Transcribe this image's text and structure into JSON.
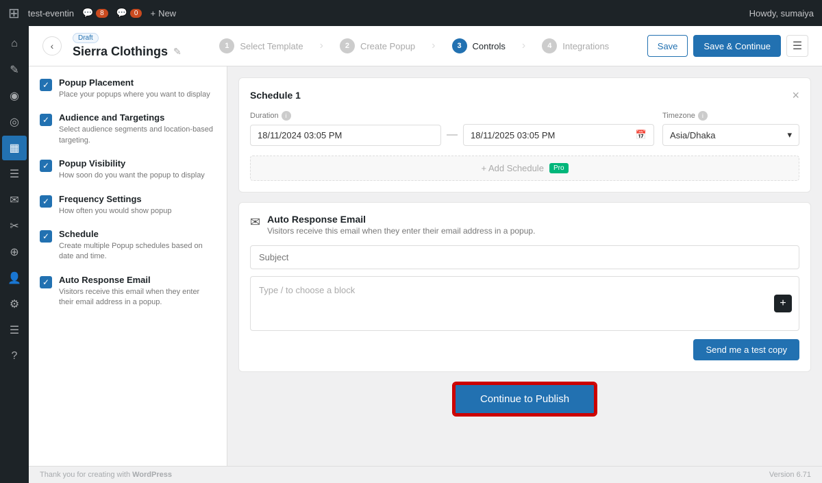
{
  "admin_bar": {
    "wp_icon": "⊞",
    "site_name": "test-eventin",
    "comments_count": "8",
    "notifications_count": "0",
    "new_label": "New",
    "howdy": "Howdy, sumaiya"
  },
  "wp_sidebar": {
    "icons": [
      {
        "name": "dashboard-icon",
        "symbol": "⌂"
      },
      {
        "name": "posts-icon",
        "symbol": "✎"
      },
      {
        "name": "users-icon",
        "symbol": "👤"
      },
      {
        "name": "analytics-icon",
        "symbol": "◎"
      },
      {
        "name": "settings-icon",
        "symbol": "⚙"
      },
      {
        "name": "plugin-icon",
        "symbol": "▦"
      },
      {
        "name": "pages-icon",
        "symbol": "☰"
      },
      {
        "name": "comments-icon",
        "symbol": "✉"
      },
      {
        "name": "tools-icon",
        "symbol": "✂"
      },
      {
        "name": "markers-icon",
        "symbol": "⊕"
      },
      {
        "name": "avatar-icon",
        "symbol": "👤"
      },
      {
        "name": "tools2-icon",
        "symbol": "✦"
      },
      {
        "name": "admin-icon",
        "symbol": "☰"
      },
      {
        "name": "help-icon",
        "symbol": "?"
      }
    ]
  },
  "header": {
    "back_label": "‹",
    "draft_label": "Draft",
    "title": "Sierra Clothings",
    "edit_icon": "✎",
    "steps": [
      {
        "number": "1",
        "label": "Select Template",
        "active": false
      },
      {
        "number": "2",
        "label": "Create Popup",
        "active": false
      },
      {
        "number": "3",
        "label": "Controls",
        "active": true
      },
      {
        "number": "4",
        "label": "Integrations",
        "active": false
      }
    ],
    "save_label": "Save",
    "save_continue_label": "Save & Continue",
    "notes_icon": "☰"
  },
  "sidebar": {
    "sections": [
      {
        "checked": true,
        "title": "Popup Placement",
        "description": "Place your popups where you want to display"
      },
      {
        "checked": true,
        "title": "Audience and Targetings",
        "description": "Select audience segments and location-based targeting."
      },
      {
        "checked": true,
        "title": "Popup Visibility",
        "description": "How soon do you want the popup to display"
      },
      {
        "checked": true,
        "title": "Frequency Settings",
        "description": "How often you would show popup"
      },
      {
        "checked": true,
        "title": "Schedule",
        "description": "Create multiple Popup schedules based on date and time."
      },
      {
        "checked": true,
        "title": "Auto Response Email",
        "description": "Visitors receive this email when they enter their email address in a popup."
      }
    ]
  },
  "schedule_card": {
    "title": "Schedule 1",
    "close_icon": "×",
    "duration_label": "Duration",
    "info_icon": "i",
    "start_date": "18/11/2024 03:05 PM",
    "end_date": "18/11/2025 03:05 PM",
    "calendar_icon": "📅",
    "timezone_label": "Timezone",
    "timezone_value": "Asia/Dhaka",
    "chevron_down": "▾",
    "add_schedule_label": "+ Add Schedule",
    "pro_badge": "Pro"
  },
  "email_card": {
    "email_icon": "✉",
    "title": "Auto Response Email",
    "description": "Visitors receive this email when they enter their email address in a popup.",
    "subject_placeholder": "Subject",
    "editor_placeholder": "Type / to choose a block",
    "add_block_icon": "+",
    "send_test_label": "Send me a test copy"
  },
  "footer": {
    "thank_you_text": "Thank you for creating with ",
    "wordpress_label": "WordPress",
    "version": "Version 6.71"
  },
  "publish_button": {
    "label": "Continue to Publish"
  }
}
